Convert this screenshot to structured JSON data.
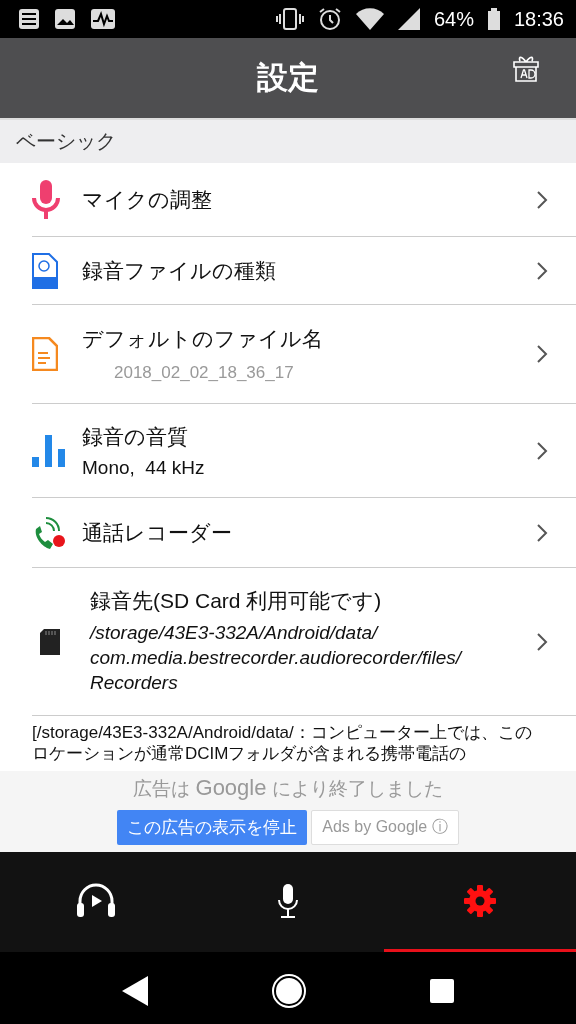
{
  "status_bar": {
    "battery": "64%",
    "time": "18:36"
  },
  "app_bar": {
    "title": "設定"
  },
  "section": {
    "title": "ベーシック"
  },
  "rows": [
    {
      "title": "マイクの調整"
    },
    {
      "title": "録音ファイルの種類"
    },
    {
      "kind": "hint",
      "title": "デフォルトのファイル名",
      "subtitle": "2018_02_02_18_36_17"
    },
    {
      "kind": "value",
      "title": "録音の音質",
      "subtitle": "Mono,  44 kHz"
    },
    {
      "title": "通話レコーダー"
    },
    {
      "kind": "path",
      "title": "録音先(SD Card 利用可能です)",
      "subtitle": "/storage/43E3-332A/Android/data/\ncom.media.bestrecorder.audiorecorder/files/\nRecorders"
    }
  ],
  "description": "[/storage/43E3-332A/Android/data/：コンピューター上では、このロケーションが通常DCIMフォルダが含まれる携帯電話の",
  "ad": {
    "message_before": "広告は",
    "brand": "Google",
    "message_after": "により終了しました",
    "stop_button": "この広告の表示を停止",
    "ads_by": "Ads by Google ⓘ"
  },
  "tabs": [
    {
      "selected": false
    },
    {
      "selected": false
    },
    {
      "selected": true
    }
  ]
}
